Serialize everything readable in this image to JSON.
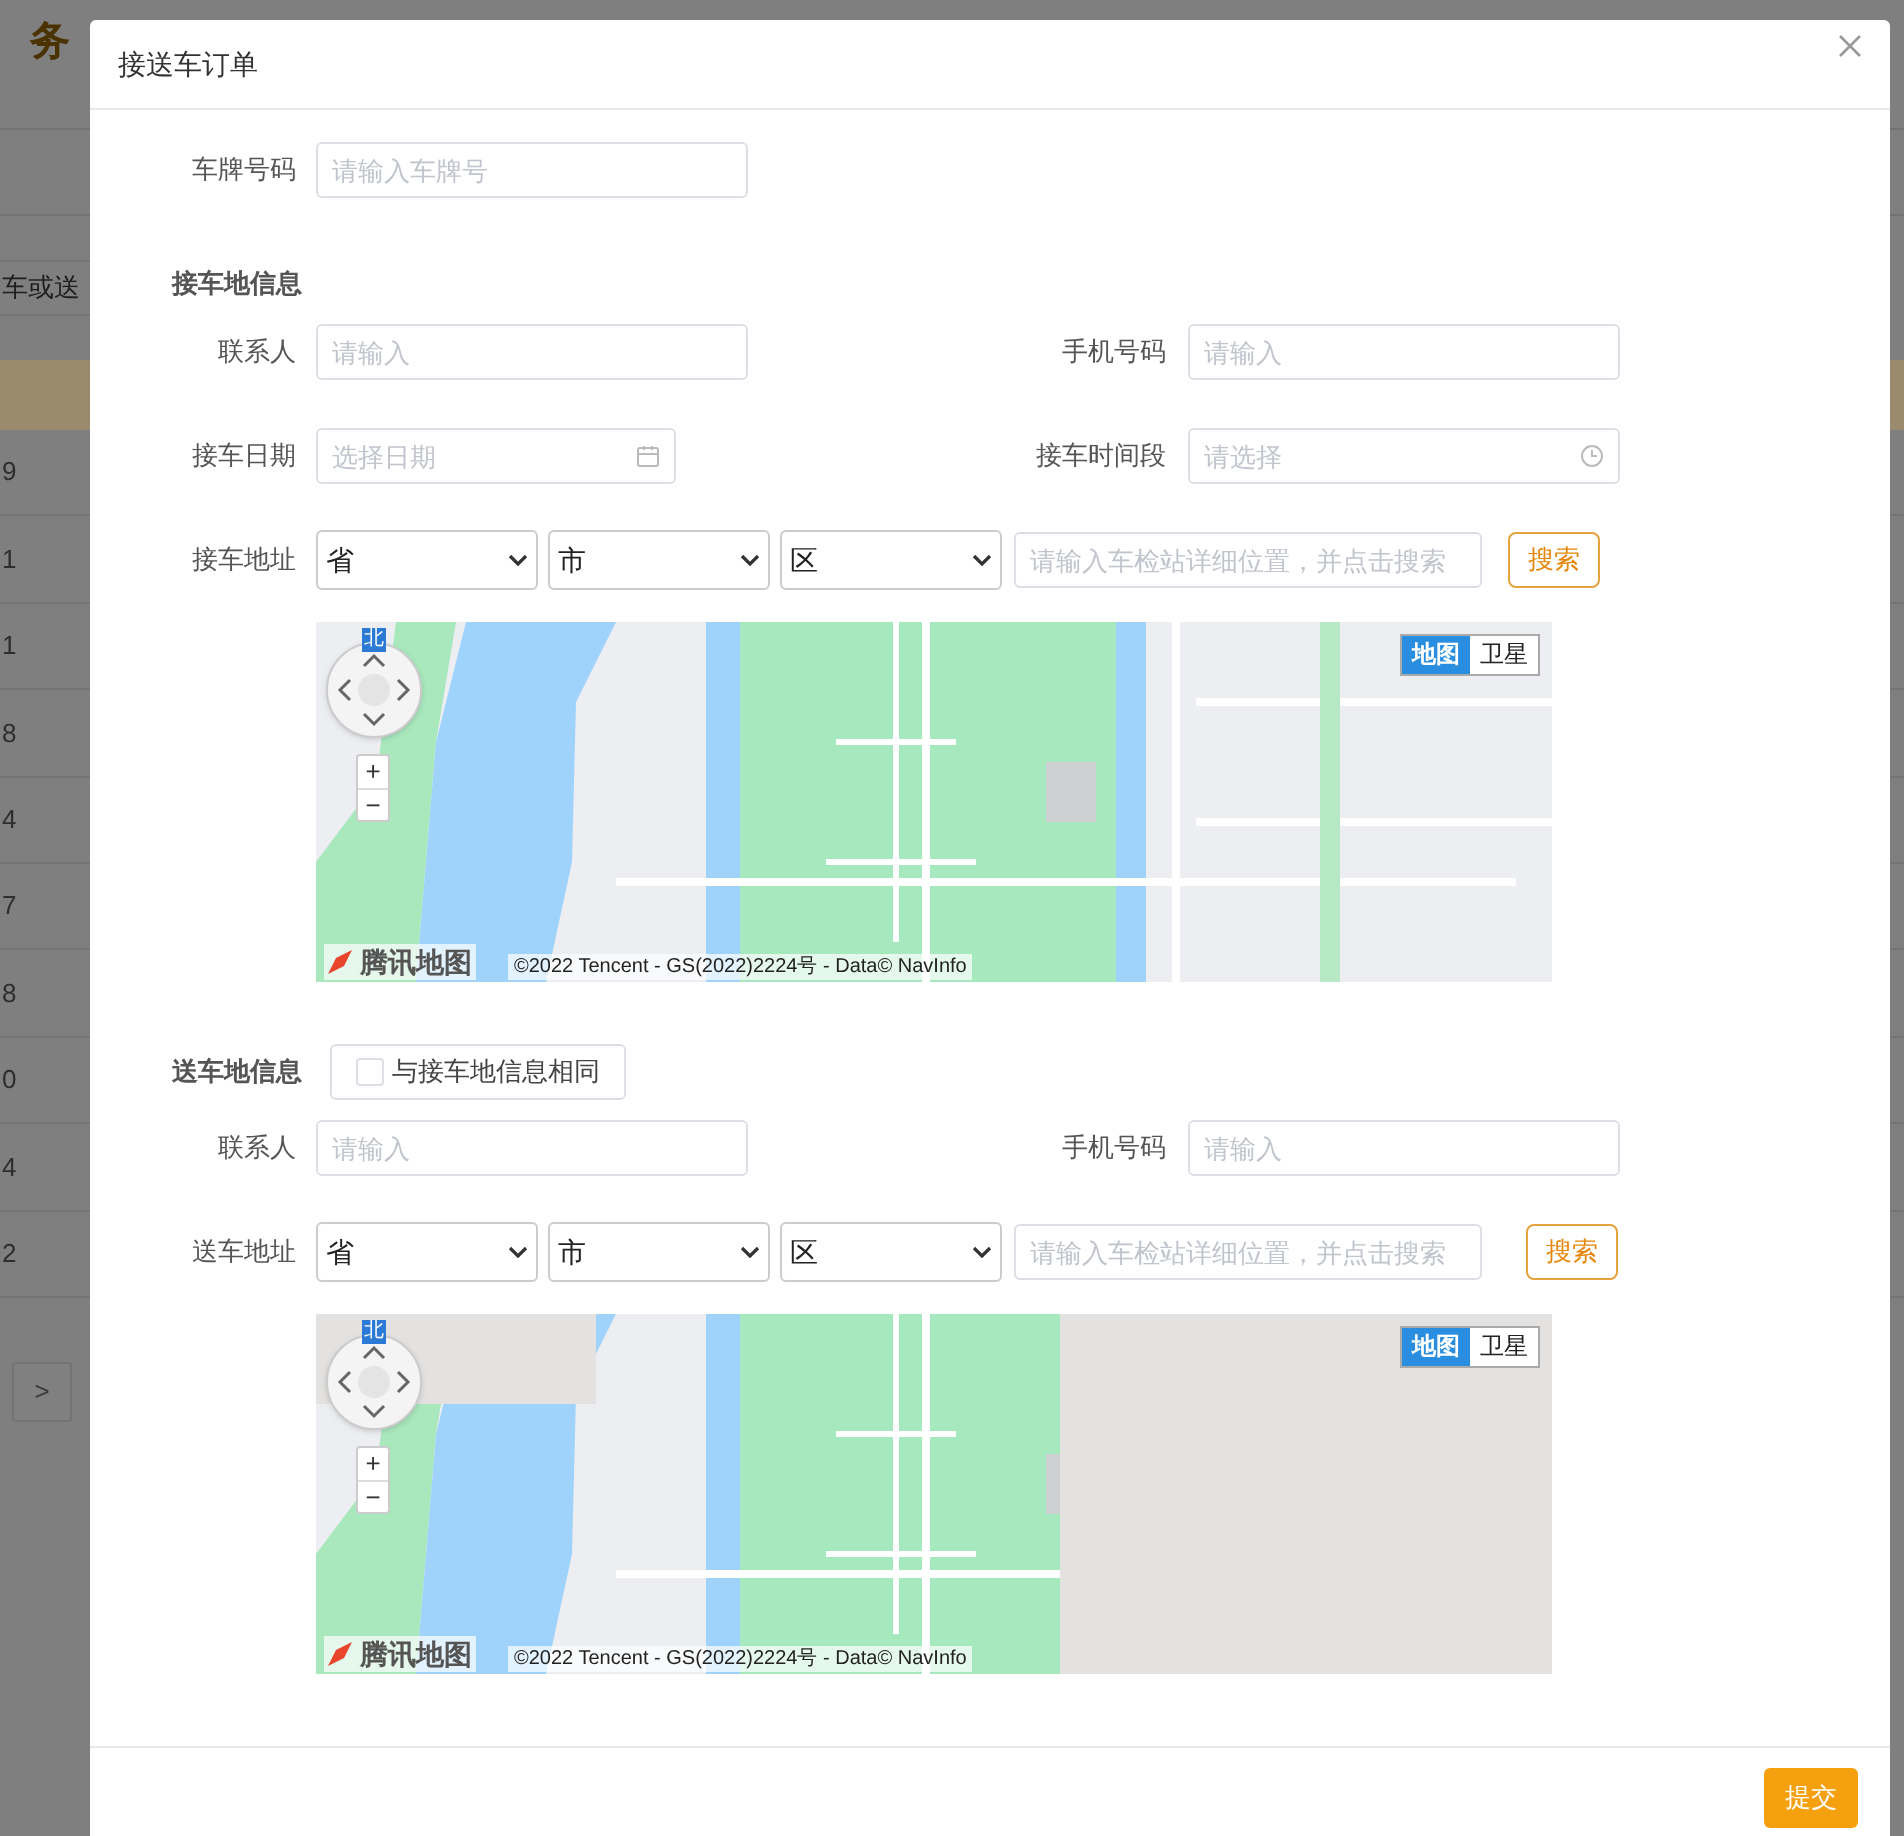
{
  "background_page": {
    "title": "务",
    "search_placeholder": "车或送",
    "rows": [
      "9",
      "1",
      "1",
      "8",
      "4",
      "7",
      "8",
      "0",
      "4",
      "2"
    ],
    "pager_next": ">"
  },
  "dialog": {
    "title": "接送车订单",
    "plate": {
      "label": "车牌号码",
      "placeholder": "请输入车牌号"
    },
    "pickup": {
      "heading": "接车地信息",
      "contact": {
        "label": "联系人",
        "placeholder": "请输入"
      },
      "phone": {
        "label": "手机号码",
        "placeholder": "请输入"
      },
      "date": {
        "label": "接车日期",
        "placeholder": "选择日期"
      },
      "time": {
        "label": "接车时间段",
        "placeholder": "请选择"
      },
      "address": {
        "label": "接车地址",
        "selects": [
          "省",
          "市",
          "区"
        ],
        "detail_placeholder": "请输入车检站详细位置，并点击搜索",
        "search_button": "搜索"
      },
      "map": {
        "kind": "picture",
        "compass_label": "北",
        "zoom_in": "+",
        "zoom_out": "−",
        "layer_tabs": [
          {
            "label": "地图",
            "selected": true
          },
          {
            "label": "卫星",
            "selected": false
          }
        ],
        "logo": "腾讯地图",
        "copyright": "©2022 Tencent - GS(2022)2224号 - Data© NavInfo"
      }
    },
    "dropoff": {
      "heading": "送车地信息",
      "same_as_pickup": {
        "label": "与接车地信息相同",
        "checked": false
      },
      "contact": {
        "label": "联系人",
        "placeholder": "请输入"
      },
      "phone": {
        "label": "手机号码",
        "placeholder": "请输入"
      },
      "address": {
        "label": "送车地址",
        "selects": [
          "省",
          "市",
          "区"
        ],
        "detail_placeholder": "请输入车检站详细位置，并点击搜索",
        "search_button": "搜索"
      },
      "map": {
        "kind": "picture",
        "blank_tiles": true,
        "compass_label": "北",
        "zoom_in": "+",
        "zoom_out": "−",
        "layer_tabs": [
          {
            "label": "地图",
            "selected": true
          },
          {
            "label": "卫星",
            "selected": false
          }
        ],
        "logo": "腾讯地图",
        "copyright": "©2022 Tencent - GS(2022)2224号 - Data© NavInfo"
      }
    },
    "submit_button": "提交"
  }
}
